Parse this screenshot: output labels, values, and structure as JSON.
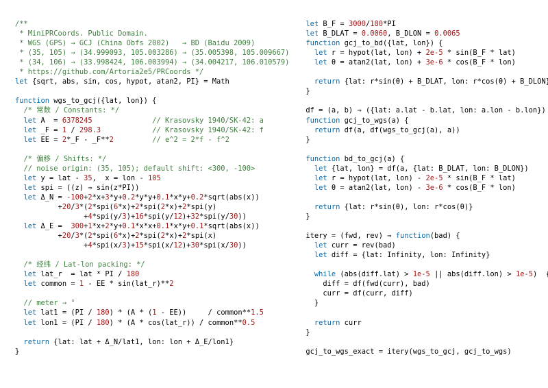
{
  "left": {
    "l1": "/**",
    "l2": " * MiniPRCoords. Public Domain.",
    "l3": " * WGS (GPS) → GCJ (China Obfs 2002)   → BD (Baidu 2009)",
    "l4": " * (35, 105) → (34.999093, 105.003286) → (35.005398, 105.009667)",
    "l5": " * (34, 106) → (33.998424, 106.003994) → (34.004217, 106.010579)",
    "l6": " * https://github.com/Artoria2e5/PRCoords */",
    "l7a": "let",
    "l7b": " {sqrt, abs, sin, cos, hypot, atan2, PI} = Math",
    "l9a": "function",
    "l9b": " wgs_to_gcj({lat, lon}) {",
    "l10": "  /* 常数 / Constants: */",
    "l11a": "  let",
    "l11b": " A  = ",
    "l11c": "6378245",
    "l11d": "              // Krasovsky 1940/SK-42: a",
    "l12a": "  let",
    "l12b": " _F = ",
    "l12c": "1",
    "l12d": " / ",
    "l12e": "298.3",
    "l12f": "            // Krasovsky 1940/SK-42: f",
    "l13a": "  let",
    "l13b": " EE = ",
    "l13c": "2",
    "l13d": "*_F - _F**",
    "l13e": "2",
    "l13f": "         // e^2 = 2*f - f^2",
    "l15": "  /* 偏移 / Shifts: */",
    "l16": "  // noise origin: (35, 105); default shift: <300, -100>",
    "l17a": "  let",
    "l17b": " y = lat - ",
    "l17c": "35",
    "l17d": ",  x = lon - ",
    "l17e": "105",
    "l18a": "  let",
    "l18b": " spi = ((z) ⇒ sin(z*PI))",
    "l19a": "  let",
    "l19b": " Δ_N = ",
    "l19c": "-100",
    "l19d": "+",
    "l19e": "2",
    "l19f": "*x+",
    "l19g": "3",
    "l19h": "*y+",
    "l19i": "0.2",
    "l19j": "*y*y+",
    "l19k": "0.1",
    "l19l": "*x*y+",
    "l19m": "0.2",
    "l19n": "*sqrt(abs(x))",
    "l20a": "          +",
    "l20b": "20",
    "l20c": "/",
    "l20d": "3",
    "l20e": "*(",
    "l20f": "2",
    "l20g": "*spi(",
    "l20h": "6",
    "l20i": "*x)+",
    "l20j": "2",
    "l20k": "*spi(",
    "l20l": "2",
    "l20m": "*x)+",
    "l20n": "2",
    "l20o": "*spi(y)",
    "l21a": "                +",
    "l21b": "4",
    "l21c": "*spi(y/",
    "l21d": "3",
    "l21e": ")+",
    "l21f": "16",
    "l21g": "*spi(y/",
    "l21h": "12",
    "l21i": ")+",
    "l21j": "32",
    "l21k": "*spi(y/",
    "l21l": "30",
    "l21m": "))",
    "l22a": "  let",
    "l22b": " Δ_E =  ",
    "l22c": "300",
    "l22d": "+",
    "l22e": "1",
    "l22f": "*x+",
    "l22g": "2",
    "l22h": "*y+",
    "l22i": "0.1",
    "l22j": "*x*x+",
    "l22k": "0.1",
    "l22l": "*x*y+",
    "l22m": "0.1",
    "l22n": "*sqrt(abs(x))",
    "l23a": "          +",
    "l23b": "20",
    "l23c": "/",
    "l23d": "3",
    "l23e": "*(",
    "l23f": "2",
    "l23g": "*spi(",
    "l23h": "6",
    "l23i": "*x)+",
    "l23j": "2",
    "l23k": "*spi(",
    "l23l": "2",
    "l23m": "*x)+",
    "l23n": "2",
    "l23o": "*spi(x)",
    "l24a": "                +",
    "l24b": "4",
    "l24c": "*spi(x/",
    "l24d": "3",
    "l24e": ")+",
    "l24f": "15",
    "l24g": "*spi(x/",
    "l24h": "12",
    "l24i": ")+",
    "l24j": "30",
    "l24k": "*spi(x/",
    "l24l": "30",
    "l24m": "))",
    "l26": "  /* 经纬 / Lat-lon packing: */",
    "l27a": "  let",
    "l27b": " lat_r  = lat * PI / ",
    "l27c": "180",
    "l28a": "  let",
    "l28b": " common = ",
    "l28c": "1",
    "l28d": " - EE * sin(lat_r)**",
    "l28e": "2",
    "l30": "  // meter → °",
    "l31a": "  let",
    "l31b": " lat1 = (PI / ",
    "l31c": "180",
    "l31d": ") * (A * (",
    "l31e": "1",
    "l31f": " - EE))     / common**",
    "l31g": "1.5",
    "l32a": "  let",
    "l32b": " lon1 = (PI / ",
    "l32c": "180",
    "l32d": ") * (A * cos(lat_r)) / common**",
    "l32e": "0.5",
    "l34a": "  return",
    "l34b": " {lat: lat + Δ_N/lat1, lon: lon + Δ_E/lon1}",
    "l35": "}"
  },
  "right": {
    "r1a": "let",
    "r1b": " B_F = ",
    "r1c": "3000",
    "r1d": "/",
    "r1e": "180",
    "r1f": "*PI",
    "r2a": "let",
    "r2b": " B_DLAT = ",
    "r2c": "0.0060",
    "r2d": ", B_DLON = ",
    "r2e": "0.0065",
    "r3a": "function",
    "r3b": " gcj_to_bd({lat, lon}) {",
    "r4a": "  let",
    "r4b": " r = hypot(lat, lon) + ",
    "r4c": "2e-5",
    "r4d": " * sin(B_F * lat)",
    "r5a": "  let",
    "r5b": " θ = atan2(lat, lon) + ",
    "r5c": "3e-6",
    "r5d": " * cos(B_F * lon)",
    "r7a": "  return",
    "r7b": " {lat: r*sin(θ) + B_DLAT, lon: r*cos(θ) + B_DLON}",
    "r8": "}",
    "r10": "df = (a, b) ⇒ ({lat: a.lat - b.lat, lon: a.lon - b.lon})",
    "r11a": "function",
    "r11b": " gcj_to_wgs(a) {",
    "r12a": "  return",
    "r12b": " df(a, df(wgs_to_gcj(a), a))",
    "r13": "}",
    "r15a": "function",
    "r15b": " bd_to_gcj(a) {",
    "r16a": "  let",
    "r16b": " {lat, lon} = df(a, {lat: B_DLAT, lon: B_DLON})",
    "r17a": "  let",
    "r17b": " r = hypot(lat, lon) - ",
    "r17c": "2e-5",
    "r17d": " * sin(B_F * lat)",
    "r18a": "  let",
    "r18b": " θ = atan2(lat, lon) - ",
    "r18c": "3e-6",
    "r18d": " * cos(B_F * lon)",
    "r20a": "  return",
    "r20b": " {lat: r*sin(θ), lon: r*cos(θ)}",
    "r21": "}",
    "r23a": "itery = (fwd, rev) ⇒ ",
    "r23b": "function",
    "r23c": "(bad) {",
    "r24a": "  let",
    "r24b": " curr = rev(bad)",
    "r25a": "  let",
    "r25b": " diff = {lat: Infinity, lon: Infinity}",
    "r27a": "  while",
    "r27b": " (abs(diff.lat) > ",
    "r27c": "1e-5",
    "r27d": " || abs(diff.lon) > ",
    "r27e": "1e-5",
    "r27f": ")  {",
    "r28": "    diff = df(fwd(curr), bad)",
    "r29": "    curr = df(curr, diff)",
    "r30": "  }",
    "r32a": "  return",
    "r32b": " curr",
    "r33": "}",
    "r35": "gcj_to_wgs_exact = itery(wgs_to_gcj, gcj_to_wgs)"
  }
}
